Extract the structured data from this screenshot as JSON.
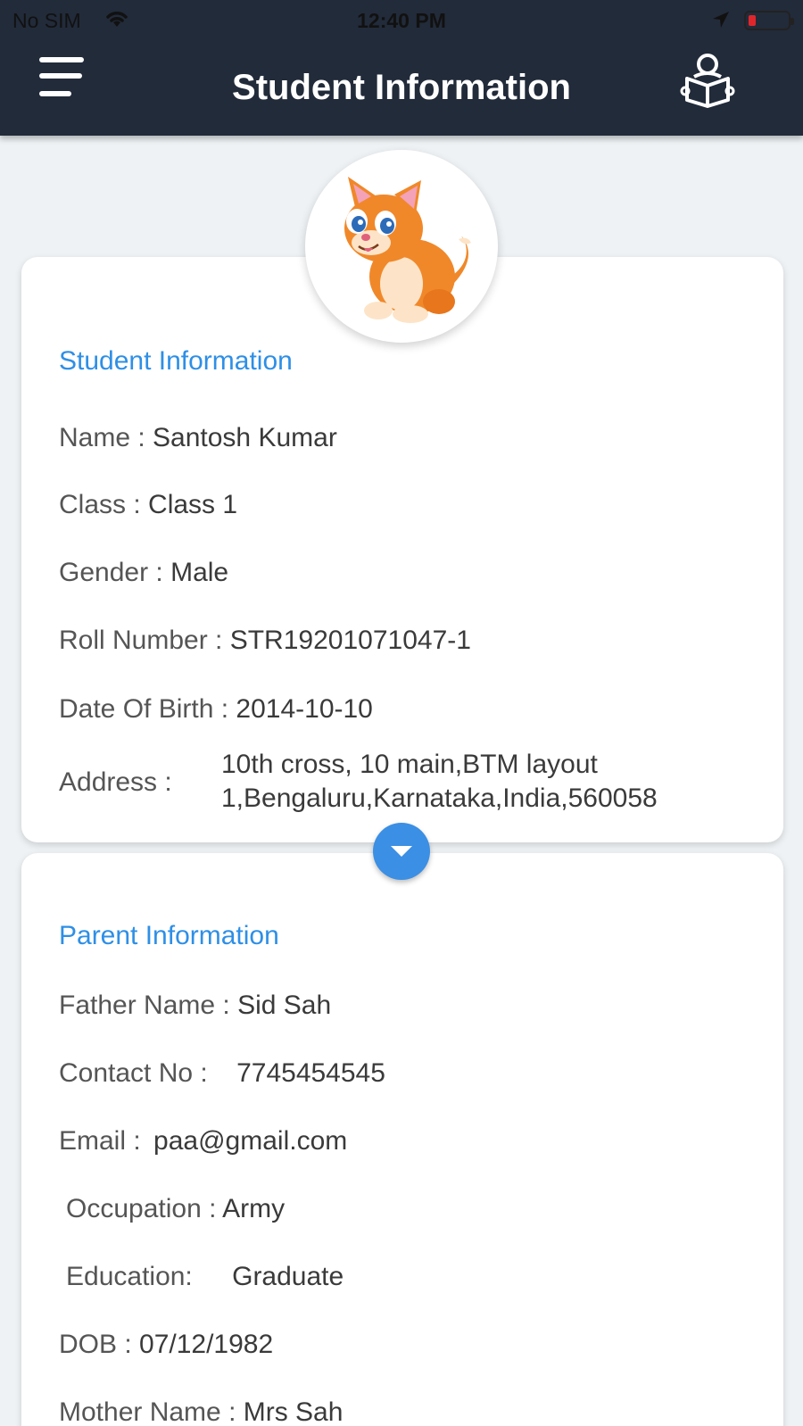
{
  "status_bar": {
    "carrier": "No SIM",
    "time": "12:40 PM"
  },
  "header": {
    "title": "Student Information",
    "menu_icon": "hamburger-menu-icon",
    "right_icon": "student-reading-icon",
    "background": "#222b3a"
  },
  "avatar": {
    "icon": "cartoon-cat-avatar"
  },
  "student_card": {
    "section_title": "Student Information",
    "name_label": "Name :",
    "name_value": "Santosh Kumar",
    "class_label": "Class :",
    "class_value": "Class 1",
    "gender_label": "Gender :",
    "gender_value": "Male",
    "roll_label": "Roll Number :",
    "roll_value": "STR19201071047-1",
    "dob_label": "Date Of Birth :",
    "dob_value": "2014-10-10",
    "address_label": "Address :",
    "address_line1": "10th cross, 10 main,BTM layout",
    "address_line2": "1,Bengaluru,Karnataka,India,560058"
  },
  "expand_button": {
    "icon": "chevron-down-icon",
    "color": "#3b8fe4"
  },
  "parent_card": {
    "section_title": "Parent Information",
    "father_label": "Father Name :",
    "father_value": "Sid Sah",
    "contact_label": "Contact No :",
    "contact_value": "7745454545",
    "email_label": "Email :",
    "email_value": "paa@gmail.com",
    "occupation_label": "Occupation :",
    "occupation_value": "Army",
    "education_label": "Education:",
    "education_value": "Graduate",
    "dob_label": "DOB :",
    "dob_value": "07/12/1982",
    "mother_label": "Mother Name :",
    "mother_value": "Mrs Sah"
  },
  "colors": {
    "accent": "#2e8fe6",
    "page_bg": "#eef2f4"
  }
}
